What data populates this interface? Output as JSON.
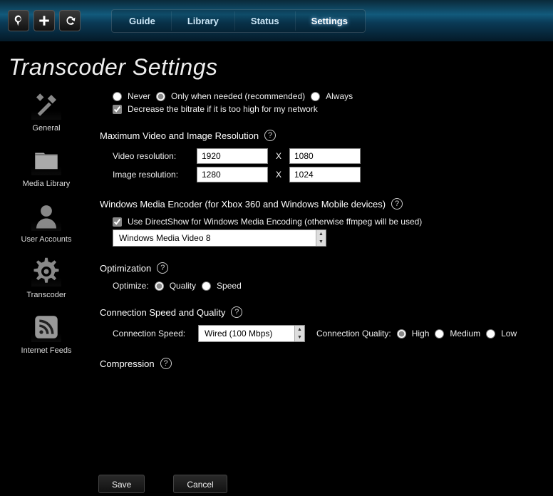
{
  "topnav": {
    "tabs": [
      "Guide",
      "Library",
      "Status",
      "Settings"
    ],
    "active": 3
  },
  "page_title": "Transcoder Settings",
  "sidebar": {
    "items": [
      {
        "label": "General"
      },
      {
        "label": "Media Library"
      },
      {
        "label": "User Accounts"
      },
      {
        "label": "Transcoder"
      },
      {
        "label": "Internet Feeds"
      }
    ]
  },
  "transcode_when": {
    "options": [
      "Never",
      "Only when needed (recommended)",
      "Always"
    ],
    "selected": 1,
    "decrease_bitrate_label": "Decrease the bitrate if it is too high for my network",
    "decrease_bitrate_checked": true
  },
  "resolution": {
    "title": "Maximum Video and Image Resolution",
    "video_label": "Video resolution:",
    "video_w": "1920",
    "video_h": "1080",
    "image_label": "Image resolution:",
    "image_w": "1280",
    "image_h": "1024",
    "sep": "X"
  },
  "wme": {
    "title": "Windows Media Encoder (for Xbox 360 and Windows Mobile devices)",
    "directshow_label": "Use DirectShow for Windows Media Encoding (otherwise ffmpeg will be used)",
    "directshow_checked": true,
    "codec": "Windows Media Video 8"
  },
  "optimization": {
    "title": "Optimization",
    "label": "Optimize:",
    "options": [
      "Quality",
      "Speed"
    ],
    "selected": 0
  },
  "connection": {
    "title": "Connection Speed and Quality",
    "speed_label": "Connection Speed:",
    "speed_value": "Wired (100 Mbps)",
    "quality_label": "Connection Quality:",
    "quality_options": [
      "High",
      "Medium",
      "Low"
    ],
    "quality_selected": 0
  },
  "compression": {
    "title": "Compression"
  },
  "buttons": {
    "save": "Save",
    "cancel": "Cancel"
  }
}
